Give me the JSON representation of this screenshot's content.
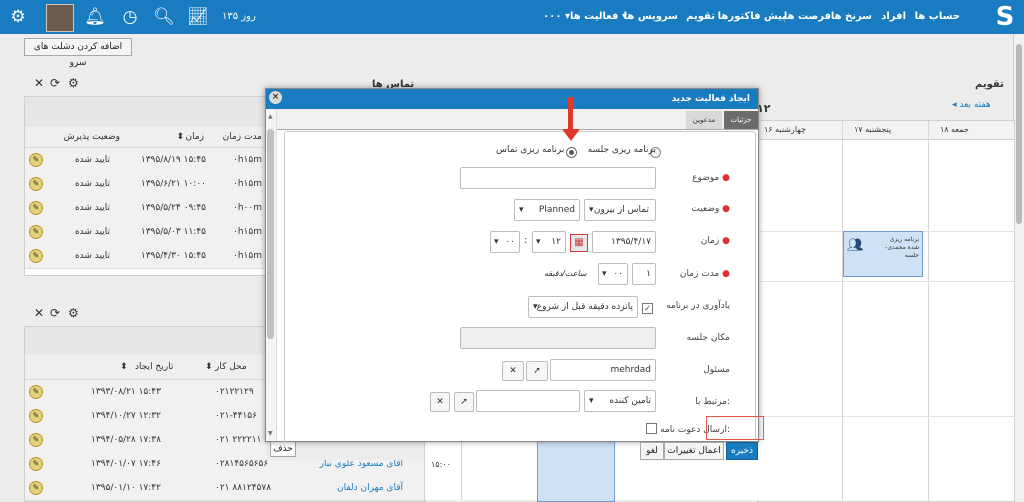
{
  "topnav": {
    "logo": "S",
    "items": [
      "حساب ها",
      "افراد",
      "سرنخ ها",
      "فرصت ها",
      "پیش فاکتورها",
      "تقویم",
      "سرویس ها",
      "فعالیت ها ▾",
      "٠٠٠ ▾"
    ],
    "days": "۱۳۵ روز"
  },
  "add_button": "اضافه کردن دشلت های سرو",
  "contacts_panel": {
    "title": "تماس ها",
    "headers": [
      "مدت زمان",
      "زمان",
      "وضعیت پذیرش"
    ],
    "rows": [
      {
        "duration": "۰h۱۵m",
        "time": "۱۳۹۵/۸/۱۹ ۱۵:۴۵",
        "status": "تایید شده"
      },
      {
        "duration": "۰h۱۵m",
        "time": "۱۳۹۵/۶/۲۱ ۱۰:۰۰",
        "status": "تایید شده"
      },
      {
        "duration": "۰h۰۰m",
        "time": "۱۳۹۵/۵/۲۴ ۰۹:۴۵",
        "status": "تایید شده"
      },
      {
        "duration": "۰h۱۵m",
        "time": "۱۳۹۵/۵/۰۳ ۱۱:۴۵",
        "status": "تایید شده"
      },
      {
        "duration": "۰h۱۵m",
        "time": "۱۳۹۵/۴/۳۰ ۱۵:۴۵",
        "status": "تایید شده"
      }
    ]
  },
  "people_panel": {
    "headers": [
      "محل کار",
      "تاریخ ایجاد"
    ],
    "rows": [
      {
        "name": "",
        "phone": "۰۲۱۲۲۱۲۹",
        "created": "۱۳۹۳/۰۸/۲۱ ۱۵:۴۳"
      },
      {
        "name": "",
        "phone": "۰۲۱-۴۴۱۵۶",
        "created": "۱۳۹۴/۱۰/۲۷ ۱۲:۳۲"
      },
      {
        "name": "محمدی",
        "phone": "۰۲۱ ۲۲۲۲۱۱",
        "created": "۱۳۹۴/۰۵/۲۸ ۱۷:۳۸"
      },
      {
        "name": "آقای مسعود علوی نیار",
        "phone": "۰۲۸۱۴۵۶۵۶۵۶",
        "created": "۱۳۹۴/۰۱/۰۷ ۱۷:۴۶"
      },
      {
        "name": "آقای مهران دلفان",
        "phone": "۰۲۱ ۸۸۱۲۴۵۷۸",
        "created": "۱۳۹۵/۰۱/۱۰ ۱۷:۴۲"
      }
    ],
    "delete_btn": "حذف"
  },
  "calendar": {
    "title": "تقویم",
    "next_week": "هفته بعد",
    "header_partial": "۱۲",
    "days": [
      "جمعه ۱۸",
      "پنجشنبه ۱۷",
      "چهارشنبه ۱۶"
    ],
    "event_text": "برنامه ریزی شده محمدی- جلسه",
    "time_label": "۱۵:۰۰"
  },
  "modal": {
    "title": "ایجاد فعالیت جدید",
    "tabs": [
      "جزئیات",
      "مدعوین"
    ],
    "type_options": [
      "برنامه ریزی جلسه",
      "برنامه ریزی تماس"
    ],
    "fields": {
      "subject_label": "موضوع",
      "status_label": "وضعیت",
      "direction_value": "تماس از بیرون",
      "status_value": "Planned",
      "time_label": "زمان",
      "date_value": "۱۳۹۵/۴/۱۷",
      "hour_value": "۱۲",
      "minute_value": "۰۰",
      "duration_label": "مدت زمان",
      "duration_hours": "۱",
      "duration_minutes": "۰۰",
      "duration_unit": "ساعت/دقیقه",
      "reminder_label": "یادآوری در برنامه",
      "reminder_value": "پانزده دقیقه قبل از شروع",
      "location_label": "مکان جلسه",
      "owner_label": "مسئول",
      "owner_value": "mehrdad",
      "related_label": "مرتبط با:",
      "related_value": "تامین کننده",
      "invite_label": "ارسال دعوت نامه:"
    },
    "buttons": {
      "save": "ذخیره",
      "apply": "اعمال تغییرات",
      "cancel": "لغو"
    }
  },
  "colors": {
    "primary": "#1a7cc0",
    "arrow": "#e0382b",
    "required": "#d9312b"
  }
}
